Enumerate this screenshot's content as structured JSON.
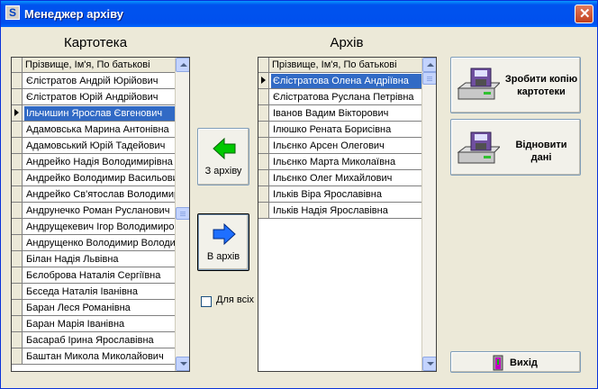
{
  "window": {
    "title": "Менеджер архіву",
    "app_icon": "app-icon",
    "close_icon": "close-icon"
  },
  "left_panel": {
    "caption": "Картотека",
    "column_header": "Прізвище, Ім'я, По батькові",
    "current_row": 2,
    "selected_row": 2,
    "rows": [
      "Єлістратов Андрій Юрійович",
      "Єлістратов Юрій Андрійович",
      "Ільчишин Ярослав Євгенович",
      "Адамовська Марина Антонівна",
      "Адамовський Юрій Тадейович",
      "Андрейко  Надія  Володимирівна",
      "Андрейко Володимир Васильович",
      "Андрейко Св'ятослав Володимирович",
      "Андрунечко Роман Русланович",
      "Андрущекевич Ігор Володимирович",
      "Андрущенко Володимир Володимирович",
      "Білан Надія Львівна",
      "Бєлоброва Наталія Сергіївна",
      "Бєседа Наталія Іванівна",
      "Баран Леся Романівна",
      "Баран Марія Іванівна",
      "Басараб Ірина Ярославівна",
      "Баштан Микола Миколайович"
    ]
  },
  "right_panel": {
    "caption": "Архів",
    "column_header": "Прізвище, Ім'я, По батькові",
    "current_row": 0,
    "selected_row": 0,
    "rows": [
      "Єлістратова Олена Андріївна",
      "Єлістратова Руслана Петрівна",
      "Іванов Вадим Вікторович",
      "Ілюшко Рената Борисівна",
      "Ільєнко Арсен Олегович",
      "Ільєнко Марта Миколаївна",
      "Ільєнко Олег Михайлович",
      "Ільків Віра Ярославівна",
      "Ільків Надія Ярославівна"
    ]
  },
  "buttons": {
    "from_archive": {
      "label": "З архіву",
      "icon": "arrow-left-icon",
      "color": "#00c800"
    },
    "to_archive": {
      "label": "В архів",
      "icon": "arrow-right-icon",
      "color": "#1e6fff"
    },
    "backup": {
      "label_line1": "Зробити копію",
      "label_line2": "картотеки",
      "icon": "disk-drive-icon"
    },
    "restore": {
      "label_line1": "Відновити",
      "label_line2": "дані",
      "icon": "disk-drive-icon"
    },
    "exit": {
      "label": "Вихід",
      "icon": "exit-door-icon"
    }
  },
  "for_all": {
    "label": "Для всіх",
    "checked": false
  }
}
